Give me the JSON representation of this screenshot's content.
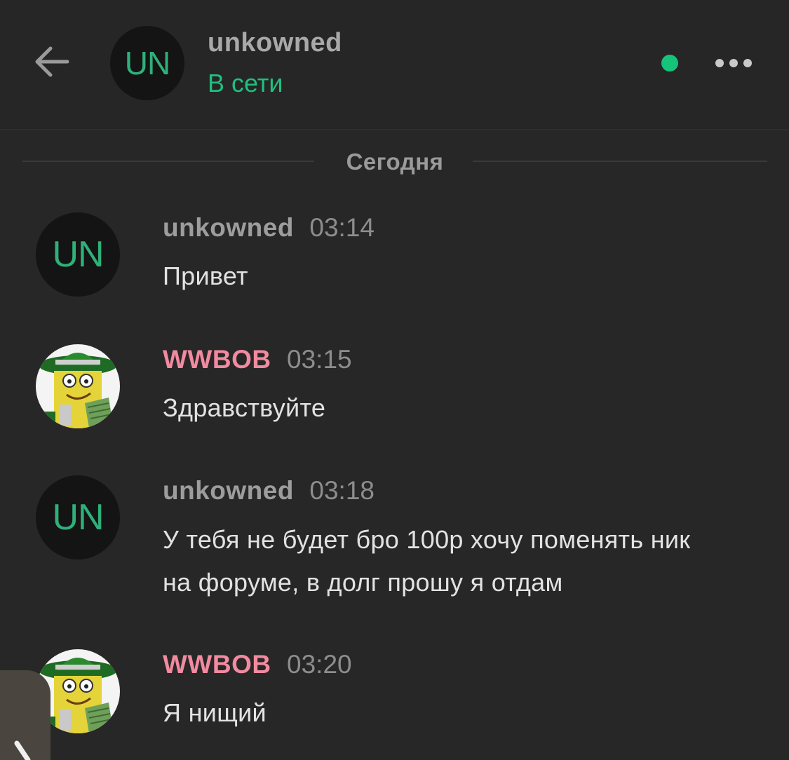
{
  "header": {
    "back_icon": "arrow-left-icon",
    "avatar_initials": "UN",
    "name": "unkowned",
    "status": "В сети",
    "online_color": "#17c27a",
    "more_icon": "more-horizontal-icon"
  },
  "date_divider": "Сегодня",
  "messages": [
    {
      "author": "unkowned",
      "time": "03:14",
      "text": "Привет",
      "avatar": "UN"
    },
    {
      "author": "WWBOB",
      "time": "03:15",
      "text": "Здравствуйте",
      "avatar": ""
    },
    {
      "author": "unkowned",
      "time": "03:18",
      "text": "У тебя не будет бро 100р хочу поменять ник на форуме, в долг прошу я отдам",
      "avatar": "UN"
    },
    {
      "author": "WWBOB",
      "time": "03:20",
      "text": "Я нищий",
      "avatar": ""
    }
  ],
  "colors": {
    "background": "#272727",
    "status_green": "#20c07e",
    "author_pink": "#f28aa0",
    "initials_green": "#2fb07a"
  }
}
